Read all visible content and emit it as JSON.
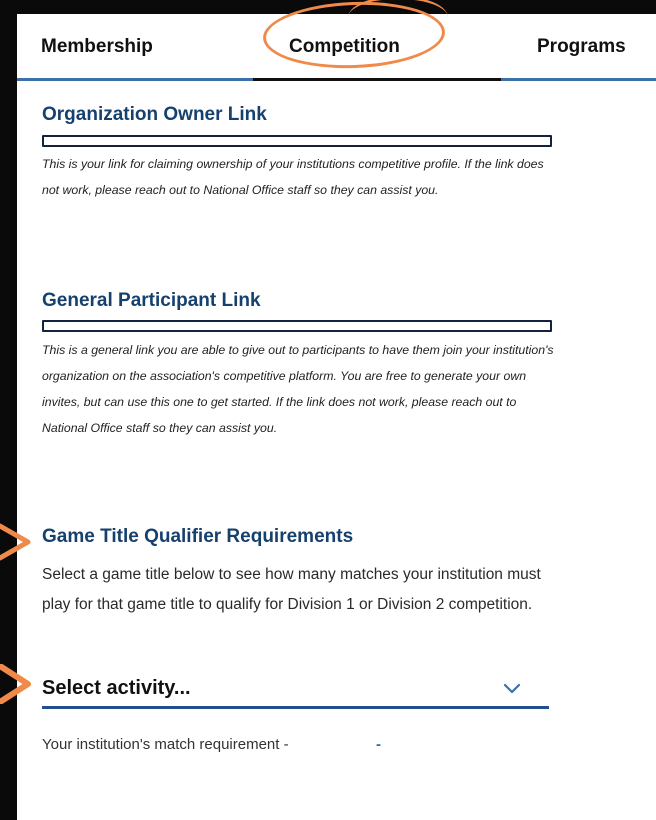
{
  "tabs": [
    {
      "label": "Membership"
    },
    {
      "label": "Competition"
    },
    {
      "label": "Programs"
    }
  ],
  "owner_link": {
    "title": "Organization Owner Link",
    "note": "This is your link for claiming ownership of your institutions competitive profile. If the link does not work, please reach out to National Office staff so they can assist you."
  },
  "participant_link": {
    "title": "General Participant Link",
    "note": "This is a general link you are able to give out to participants to have them join your institution's organization on the association's competitive platform. You are free to generate your own invites, but can use this one to get started. If the link does not work, please reach out to National Office staff so they can assist you."
  },
  "qualifier": {
    "title": "Game Title Qualifier Requirements",
    "description": "Select a game title below to see how many matches your institution must play for that game title to qualify for Division 1 or Division 2 competition.",
    "select_label": "Select activity...",
    "requirement_label": "Your institution's match requirement -",
    "requirement_value": "-"
  },
  "colors": {
    "heading": "#16416e",
    "accent_blue": "#3c71a8",
    "annotation_orange": "#ef8a4a"
  }
}
